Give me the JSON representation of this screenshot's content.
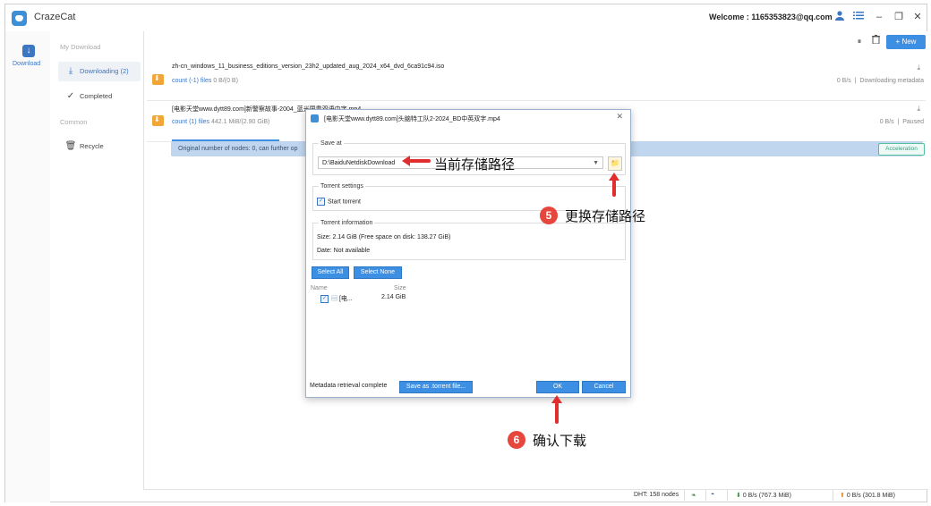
{
  "app": {
    "name": "CrazeCat",
    "welcome": "Welcome : 1165353823@qq.com"
  },
  "titlebar": {
    "user_icon": "user-icon",
    "menu_icon": "list-icon",
    "minimize": "–",
    "restore": "❐",
    "close": "✕"
  },
  "sidenav": {
    "download_label": "Download"
  },
  "sidebar": {
    "my_download": "My Download",
    "items": [
      {
        "label": "Downloading (2)",
        "icon": "download-icon",
        "active": true
      },
      {
        "label": "Completed",
        "icon": "check-circle-icon",
        "active": false
      }
    ],
    "common": "Common",
    "recycle": "Recycle"
  },
  "toolbar": {
    "pause": "⏸",
    "delete": "🗑",
    "new_label": "+ New"
  },
  "downloads": [
    {
      "name": "zh-cn_windows_11_business_editions_version_23h2_updated_aug_2024_x64_dvd_6ca91c94.iso",
      "count": "count (-1) files",
      "size": "0 B/(0 B)",
      "speed": "0 B/s",
      "status": "Downloading metadata"
    },
    {
      "name": "[电影天堂www.dytt89.com]新警察故事-2004_蓝光国粤双语中字.mp4",
      "count": "count (1) files",
      "size": "442.1 MiB/(2.90 GiB)",
      "speed": "0 B/s",
      "status": "Paused"
    }
  ],
  "nodes_message": "Original number of nodes: 0, can further op",
  "acceleration": "Acceleration",
  "statusbar": {
    "dht": "DHT: 158 nodes",
    "down": "0 B/s (767.3 MiB)",
    "up": "0 B/s (301.8 MiB)"
  },
  "dialog": {
    "title": "[电影天堂www.dytt89.com]头脑特工队2-2024_BD中英双字.mp4",
    "save_at": "Save at",
    "path": "D:\\BaiduNetdiskDownload",
    "torrent_settings": "Torrent settings",
    "start_torrent": "Start torrent",
    "torrent_information": "Torrent information",
    "size_info": "Size:  2.14 GiB (Free space on disk: 138.27 GiB)",
    "date_info": "Date:  Not available",
    "select_all": "Select All",
    "select_none": "Select None",
    "col_name": "Name",
    "col_size": "Size",
    "file_name": "[电...",
    "file_size": "2.14 GiB",
    "metadata_status": "Metadata retrieval complete",
    "save_torrent": "Save as .torrent file...",
    "ok": "OK",
    "cancel": "Cancel"
  },
  "annotations": {
    "current_path": "当前存储路径",
    "step5_num": "5",
    "step5_text": "更换存储路径",
    "step6_num": "6",
    "step6_text": "确认下载"
  },
  "colors": {
    "accent": "#3c8fe3",
    "folder": "#f1a637",
    "annotation_red": "#e02e2e"
  }
}
